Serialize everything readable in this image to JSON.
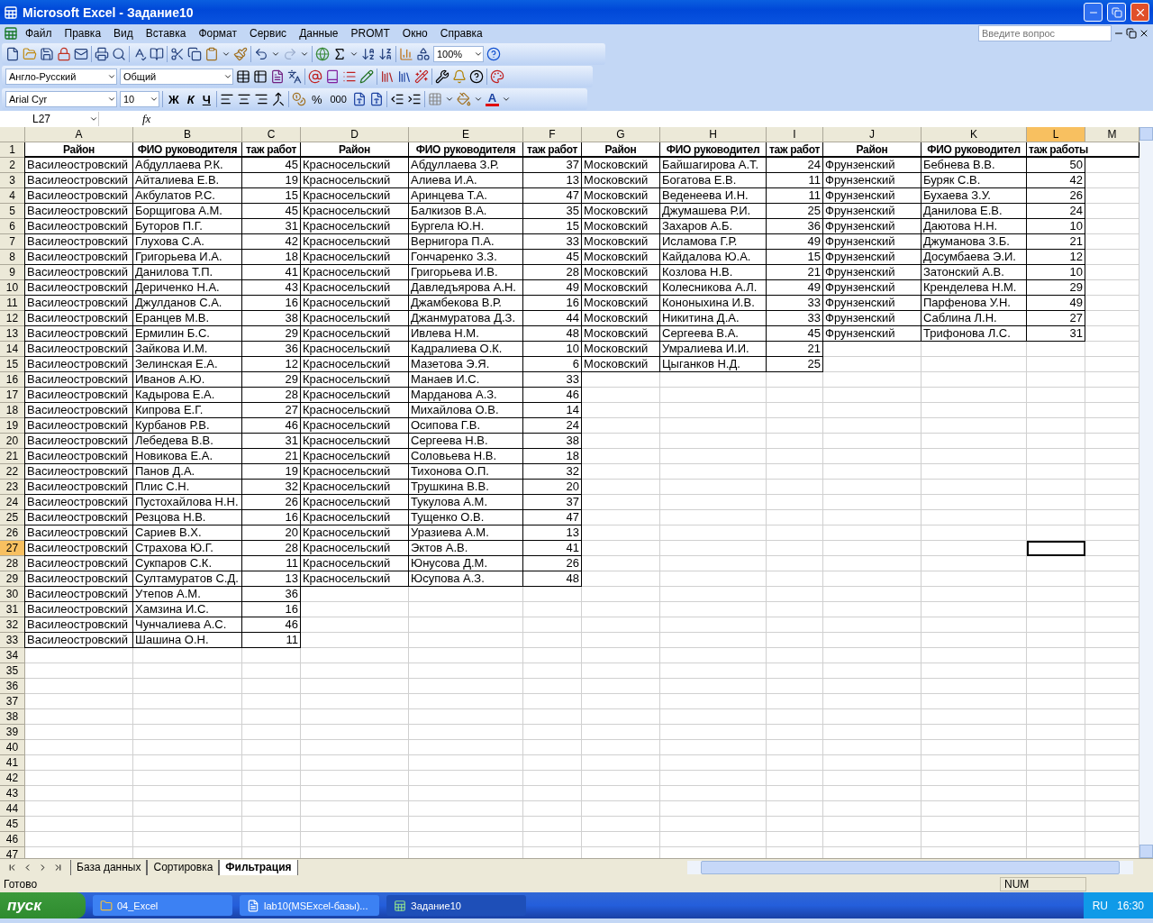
{
  "window": {
    "title": "Microsoft Excel - Задание10"
  },
  "menu": [
    {
      "label": "Файл"
    },
    {
      "label": "Правка"
    },
    {
      "label": "Вид"
    },
    {
      "label": "Вставка"
    },
    {
      "label": "Формат"
    },
    {
      "label": "Сервис"
    },
    {
      "label": "Данные"
    },
    {
      "label": "PROMT"
    },
    {
      "label": "Окно"
    },
    {
      "label": "Справка"
    }
  ],
  "help_box": {
    "placeholder": "Введите вопрос"
  },
  "standard_toolbar": {
    "zoom": "100%"
  },
  "promt_toolbar": {
    "direction": "Англо-Русский",
    "format": "Общий"
  },
  "formatting_toolbar": {
    "font": "Arial Cyr",
    "size": "10",
    "bold": "Ж",
    "italic": "К",
    "underline": "Ч",
    "percent": "%",
    "thousands": "000",
    "font_color": "A"
  },
  "formula_bar": {
    "name_box": "L27",
    "fx": "fx"
  },
  "sheet": {
    "columns": [
      {
        "letter": "A",
        "kind": "text",
        "selected": false
      },
      {
        "letter": "B",
        "kind": "text",
        "selected": false
      },
      {
        "letter": "C",
        "kind": "number",
        "selected": false
      },
      {
        "letter": "D",
        "kind": "text",
        "selected": false
      },
      {
        "letter": "E",
        "kind": "text",
        "selected": false
      },
      {
        "letter": "F",
        "kind": "number",
        "selected": false
      },
      {
        "letter": "G",
        "kind": "text",
        "selected": false
      },
      {
        "letter": "H",
        "kind": "text",
        "selected": false
      },
      {
        "letter": "I",
        "kind": "number",
        "selected": false
      },
      {
        "letter": "J",
        "kind": "text",
        "selected": false
      },
      {
        "letter": "K",
        "kind": "text",
        "selected": false
      },
      {
        "letter": "L",
        "kind": "number",
        "selected": true
      },
      {
        "letter": "M",
        "kind": "text",
        "selected": false
      }
    ],
    "rows": [
      {
        "number": "1",
        "kind": "header",
        "selected": false,
        "cells": [
          "Район",
          "ФИО руководителя",
          "таж работ",
          "Район",
          "ФИО руководителя",
          "таж работ",
          "Район",
          "ФИО руководител",
          "таж работ",
          "Район",
          "ФИО руководител",
          "таж работы"
        ]
      },
      {
        "number": "2",
        "kind": "data",
        "selected": false,
        "cells": [
          "Василеостровский",
          "Абдуллаева Р.К.",
          "45",
          "Красносельский",
          "Абдуллаева З.Р.",
          "37",
          "Московский",
          "Байшагирова А.Т.",
          "24",
          "Фрунзенский",
          "Бебнева В.В.",
          "50"
        ]
      },
      {
        "number": "3",
        "kind": "data",
        "selected": false,
        "cells": [
          "Василеостровский",
          "Айталиева Е.В.",
          "19",
          "Красносельский",
          "Алиева И.А.",
          "13",
          "Московский",
          "Богатова Е.В.",
          "11",
          "Фрунзенский",
          "Буряк С.В.",
          "42"
        ]
      },
      {
        "number": "4",
        "kind": "data",
        "selected": false,
        "cells": [
          "Василеостровский",
          "Акбулатов Р.С.",
          "15",
          "Красносельский",
          "Аринцева Т.А.",
          "47",
          "Московский",
          "Веденеева И.Н.",
          "11",
          "Фрунзенский",
          "Бухаева З.У.",
          "26"
        ]
      },
      {
        "number": "5",
        "kind": "data",
        "selected": false,
        "cells": [
          "Василеостровский",
          "Борщигова А.М.",
          "45",
          "Красносельский",
          "Балкизов В.А.",
          "35",
          "Московский",
          "Джумашева Р.И.",
          "25",
          "Фрунзенский",
          "Данилова Е.В.",
          "24"
        ]
      },
      {
        "number": "6",
        "kind": "data",
        "selected": false,
        "cells": [
          "Василеостровский",
          "Буторов П.Г.",
          "31",
          "Красносельский",
          "Бургела Ю.Н.",
          "15",
          "Московский",
          "Захаров А.Б.",
          "36",
          "Фрунзенский",
          "Даютова Н.Н.",
          "10"
        ]
      },
      {
        "number": "7",
        "kind": "data",
        "selected": false,
        "cells": [
          "Василеостровский",
          "Глухова С.А.",
          "42",
          "Красносельский",
          "Вернигора П.А.",
          "33",
          "Московский",
          "Исламова Г.Р.",
          "49",
          "Фрунзенский",
          "Джуманова З.Б.",
          "21"
        ]
      },
      {
        "number": "8",
        "kind": "data",
        "selected": false,
        "cells": [
          "Василеостровский",
          "Григорьева И.А.",
          "18",
          "Красносельский",
          "Гончаренко З.З.",
          "45",
          "Московский",
          "Кайдалова Ю.А.",
          "15",
          "Фрунзенский",
          "Досумбаева Э.И.",
          "12"
        ]
      },
      {
        "number": "9",
        "kind": "data",
        "selected": false,
        "cells": [
          "Василеостровский",
          "Данилова Т.П.",
          "41",
          "Красносельский",
          "Григорьева И.В.",
          "28",
          "Московский",
          "Козлова Н.В.",
          "21",
          "Фрунзенский",
          "Затонский А.В.",
          "10"
        ]
      },
      {
        "number": "10",
        "kind": "data",
        "selected": false,
        "cells": [
          "Василеостровский",
          "Дериченко Н.А.",
          "43",
          "Красносельский",
          "Давледъярова А.Н.",
          "49",
          "Московский",
          "Колесникова А.Л.",
          "49",
          "Фрунзенский",
          "Кренделева Н.М.",
          "29"
        ]
      },
      {
        "number": "11",
        "kind": "data",
        "selected": false,
        "cells": [
          "Василеостровский",
          "Джулданов С.А.",
          "16",
          "Красносельский",
          "Джамбекова В.Р.",
          "16",
          "Московский",
          "Кононыхина И.В.",
          "33",
          "Фрунзенский",
          "Парфенова У.Н.",
          "49"
        ]
      },
      {
        "number": "12",
        "kind": "data",
        "selected": false,
        "cells": [
          "Василеостровский",
          "Еранцев М.В.",
          "38",
          "Красносельский",
          "Джанмуратова Д.З.",
          "44",
          "Московский",
          "Никитина Д.А.",
          "33",
          "Фрунзенский",
          "Саблина Л.Н.",
          "27"
        ]
      },
      {
        "number": "13",
        "kind": "data",
        "selected": false,
        "cells": [
          "Василеостровский",
          "Ермилин Б.С.",
          "29",
          "Красносельский",
          "Ивлева Н.М.",
          "48",
          "Московский",
          "Сергеева В.А.",
          "45",
          "Фрунзенский",
          "Трифонова Л.С.",
          "31"
        ]
      },
      {
        "number": "14",
        "kind": "data",
        "selected": false,
        "cells": [
          "Василеостровский",
          "Зайкова И.М.",
          "36",
          "Красносельский",
          "Кадралиева О.К.",
          "10",
          "Московский",
          "Умралиева И.И.",
          "21",
          null,
          null,
          null
        ]
      },
      {
        "number": "15",
        "kind": "data",
        "selected": false,
        "cells": [
          "Василеостровский",
          "Зелинская Е.А.",
          "12",
          "Красносельский",
          "Мазетова Э.Я.",
          "6",
          "Московский",
          "Цыганков Н.Д.",
          "25",
          null,
          null,
          null
        ]
      },
      {
        "number": "16",
        "kind": "data",
        "selected": false,
        "cells": [
          "Василеостровский",
          "Иванов А.Ю.",
          "29",
          "Красносельский",
          "Манаев И.С.",
          "33",
          null,
          null,
          null,
          null,
          null,
          null
        ]
      },
      {
        "number": "17",
        "kind": "data",
        "selected": false,
        "cells": [
          "Василеостровский",
          "Кадырова Е.А.",
          "28",
          "Красносельский",
          "Марданова А.З.",
          "46",
          null,
          null,
          null,
          null,
          null,
          null
        ]
      },
      {
        "number": "18",
        "kind": "data",
        "selected": false,
        "cells": [
          "Василеостровский",
          "Кипрова Е.Г.",
          "27",
          "Красносельский",
          "Михайлова О.В.",
          "14",
          null,
          null,
          null,
          null,
          null,
          null
        ]
      },
      {
        "number": "19",
        "kind": "data",
        "selected": false,
        "cells": [
          "Василеостровский",
          "Курбанов Р.В.",
          "46",
          "Красносельский",
          "Осипова Г.В.",
          "24",
          null,
          null,
          null,
          null,
          null,
          null
        ]
      },
      {
        "number": "20",
        "kind": "data",
        "selected": false,
        "cells": [
          "Василеостровский",
          "Лебедева В.В.",
          "31",
          "Красносельский",
          "Сергеева Н.В.",
          "38",
          null,
          null,
          null,
          null,
          null,
          null
        ]
      },
      {
        "number": "21",
        "kind": "data",
        "selected": false,
        "cells": [
          "Василеостровский",
          "Новикова Е.А.",
          "21",
          "Красносельский",
          "Соловьева Н.В.",
          "18",
          null,
          null,
          null,
          null,
          null,
          null
        ]
      },
      {
        "number": "22",
        "kind": "data",
        "selected": false,
        "cells": [
          "Василеостровский",
          "Панов Д.А.",
          "19",
          "Красносельский",
          "Тихонова О.П.",
          "32",
          null,
          null,
          null,
          null,
          null,
          null
        ]
      },
      {
        "number": "23",
        "kind": "data",
        "selected": false,
        "cells": [
          "Василеостровский",
          "Плис С.Н.",
          "32",
          "Красносельский",
          "Трушкина В.В.",
          "20",
          null,
          null,
          null,
          null,
          null,
          null
        ]
      },
      {
        "number": "24",
        "kind": "data",
        "selected": false,
        "cells": [
          "Василеостровский",
          "Пустохайлова Н.Н.",
          "26",
          "Красносельский",
          "Тукулова А.М.",
          "37",
          null,
          null,
          null,
          null,
          null,
          null
        ]
      },
      {
        "number": "25",
        "kind": "data",
        "selected": false,
        "cells": [
          "Василеостровский",
          "Резцова Н.В.",
          "16",
          "Красносельский",
          "Тущенко О.В.",
          "47",
          null,
          null,
          null,
          null,
          null,
          null
        ]
      },
      {
        "number": "26",
        "kind": "data",
        "selected": false,
        "cells": [
          "Василеостровский",
          "Сариев В.Х.",
          "20",
          "Красносельский",
          "Уразиева А.М.",
          "13",
          null,
          null,
          null,
          null,
          null,
          null
        ]
      },
      {
        "number": "27",
        "kind": "data",
        "selected": true,
        "cells": [
          "Василеостровский",
          "Страхова Ю.Г.",
          "28",
          "Красносельский",
          "Эктов А.В.",
          "41",
          null,
          null,
          null,
          null,
          null,
          null
        ]
      },
      {
        "number": "28",
        "kind": "data",
        "selected": false,
        "cells": [
          "Василеостровский",
          "Сукпаров С.К.",
          "11",
          "Красносельский",
          "Юнусова Д.М.",
          "26",
          null,
          null,
          null,
          null,
          null,
          null
        ]
      },
      {
        "number": "29",
        "kind": "data",
        "selected": false,
        "cells": [
          "Василеостровский",
          "Султамуратов С.Д.",
          "13",
          "Красносельский",
          "Юсупова А.З.",
          "48",
          null,
          null,
          null,
          null,
          null,
          null
        ]
      },
      {
        "number": "30",
        "kind": "data",
        "selected": false,
        "cells": [
          "Василеостровский",
          "Утепов А.М.",
          "36",
          null,
          null,
          null,
          null,
          null,
          null,
          null,
          null,
          null
        ]
      },
      {
        "number": "31",
        "kind": "data",
        "selected": false,
        "cells": [
          "Василеостровский",
          "Хамзина И.С.",
          "16",
          null,
          null,
          null,
          null,
          null,
          null,
          null,
          null,
          null
        ]
      },
      {
        "number": "32",
        "kind": "data",
        "selected": false,
        "cells": [
          "Василеостровский",
          "Чунчалиева А.С.",
          "46",
          null,
          null,
          null,
          null,
          null,
          null,
          null,
          null,
          null
        ]
      },
      {
        "number": "33",
        "kind": "data",
        "selected": false,
        "cells": [
          "Василеостровский",
          "Шашина О.Н.",
          "11",
          null,
          null,
          null,
          null,
          null,
          null,
          null,
          null,
          null
        ]
      },
      {
        "number": "34",
        "kind": "data",
        "selected": false
      },
      {
        "number": "35",
        "kind": "data",
        "selected": false
      },
      {
        "number": "36",
        "kind": "data",
        "selected": false
      },
      {
        "number": "37",
        "kind": "data",
        "selected": false
      },
      {
        "number": "38",
        "kind": "data",
        "selected": false
      },
      {
        "number": "39",
        "kind": "data",
        "selected": false
      },
      {
        "number": "40",
        "kind": "data",
        "selected": false
      },
      {
        "number": "41",
        "kind": "data",
        "selected": false
      },
      {
        "number": "42",
        "kind": "data",
        "selected": false
      },
      {
        "number": "43",
        "kind": "data",
        "selected": false
      },
      {
        "number": "44",
        "kind": "data",
        "selected": false
      },
      {
        "number": "45",
        "kind": "data",
        "selected": false
      },
      {
        "number": "46",
        "kind": "data",
        "selected": false
      },
      {
        "number": "47",
        "kind": "data",
        "selected": false
      }
    ]
  },
  "sheet_tabs": [
    {
      "label": "База данных",
      "selected": false
    },
    {
      "label": "Сортировка",
      "selected": false
    },
    {
      "label": "Фильтрация",
      "selected": true
    }
  ],
  "status_bar": {
    "text": "Готово",
    "indicator": "NUM"
  },
  "taskbar": {
    "start": "пуск",
    "tasks": [
      {
        "label": "04_Excel",
        "kind": "folder",
        "selected": false
      },
      {
        "label": "lab10(MSExcel-базы)...",
        "kind": "document",
        "selected": false
      },
      {
        "label": "Задание10",
        "kind": "excel",
        "selected": true
      }
    ],
    "language": "RU",
    "time": "16:30"
  }
}
